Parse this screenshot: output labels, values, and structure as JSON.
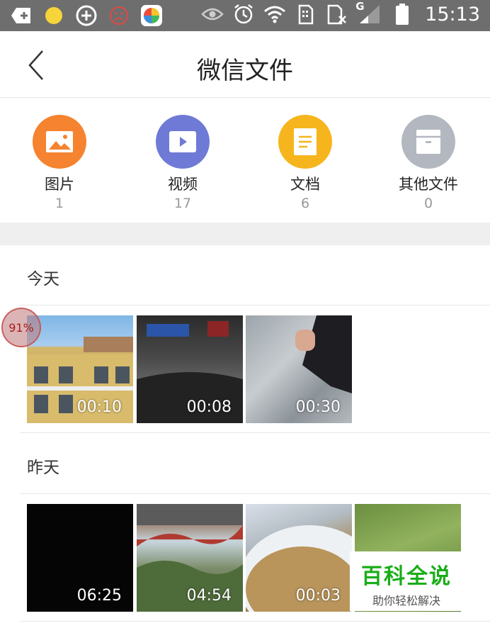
{
  "status_bar": {
    "time": "15:13",
    "network": "G"
  },
  "header": {
    "title": "微信文件"
  },
  "categories": [
    {
      "label": "图片",
      "count": "1",
      "color": "#f5832f",
      "icon": "image-icon"
    },
    {
      "label": "视频",
      "count": "17",
      "color": "#6f7ad6",
      "icon": "video-icon"
    },
    {
      "label": "文档",
      "count": "6",
      "color": "#f6b51c",
      "icon": "document-icon"
    },
    {
      "label": "其他文件",
      "count": "0",
      "color": "#b3b8c0",
      "icon": "archive-icon"
    }
  ],
  "sections": [
    {
      "title": "今天",
      "items": [
        {
          "duration": "00:10"
        },
        {
          "duration": "00:08"
        },
        {
          "duration": "00:30"
        }
      ]
    },
    {
      "title": "昨天",
      "items": [
        {
          "duration": "06:25"
        },
        {
          "duration": "04:54"
        },
        {
          "duration": "00:03"
        },
        {
          "duration": ""
        }
      ]
    }
  ],
  "badge": {
    "text": "91%"
  },
  "watermark": {
    "title": "百科全说",
    "subtitle": "助你轻松解决"
  }
}
